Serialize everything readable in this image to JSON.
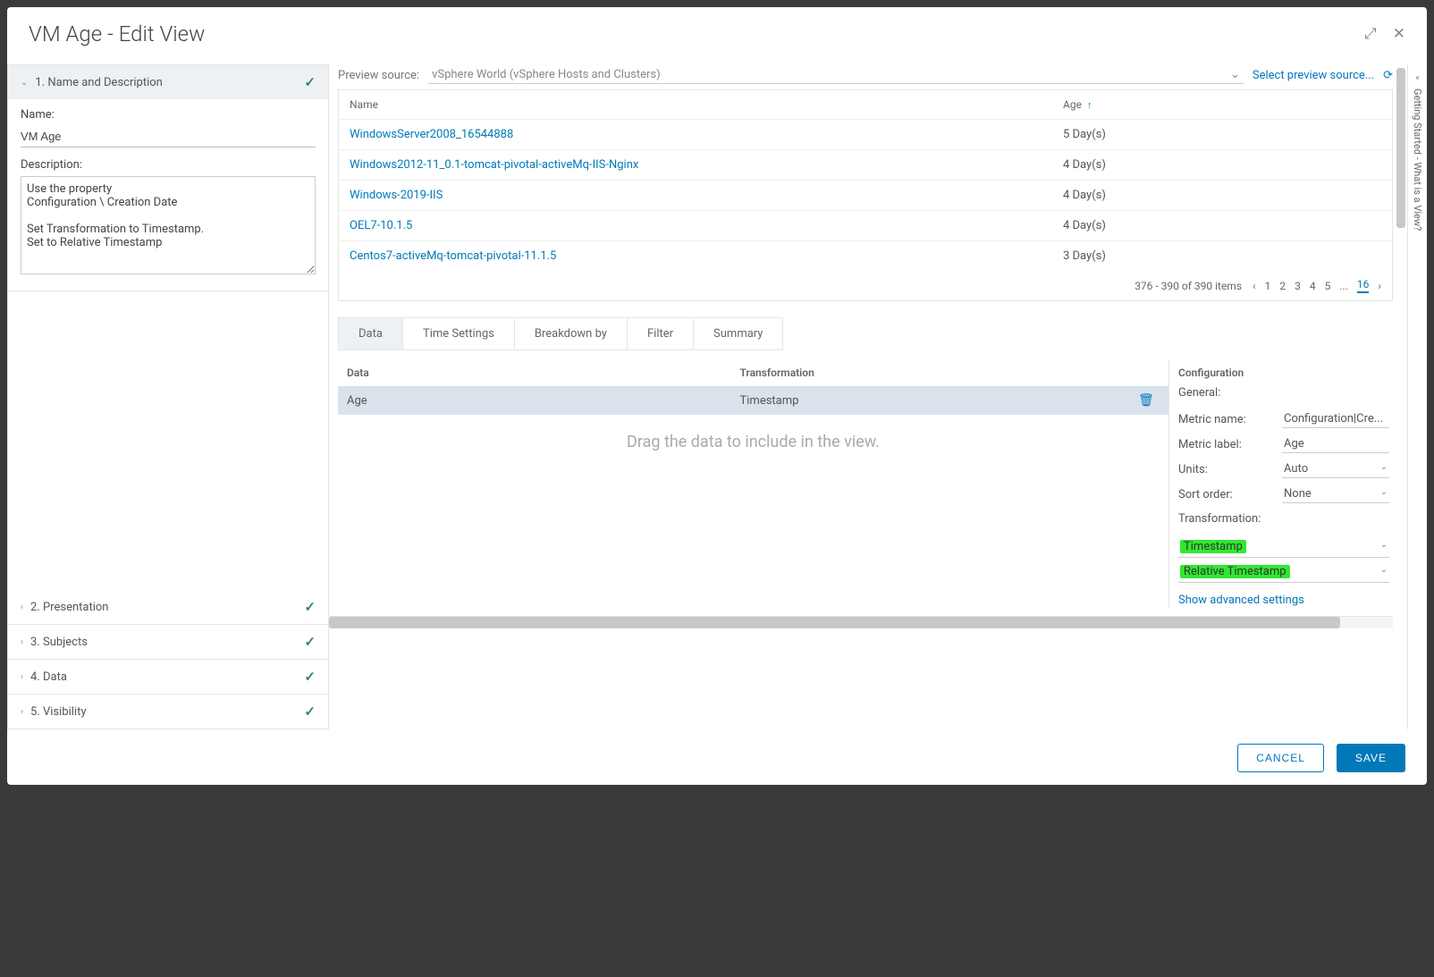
{
  "dialog": {
    "title": "VM Age - Edit View",
    "cancel": "CANCEL",
    "save": "SAVE"
  },
  "sidebar": {
    "items": [
      {
        "label": "1. Name and Description",
        "expanded": true
      },
      {
        "label": "2. Presentation",
        "expanded": false
      },
      {
        "label": "3. Subjects",
        "expanded": false
      },
      {
        "label": "4. Data",
        "expanded": false
      },
      {
        "label": "5. Visibility",
        "expanded": false
      }
    ],
    "form": {
      "name_label": "Name:",
      "name_value": "VM Age",
      "desc_label": "Description:",
      "desc_value": "Use the property\nConfiguration \\ Creation Date\n\nSet Transformation to Timestamp.\nSet to Relative Timestamp"
    }
  },
  "preview": {
    "label": "Preview source:",
    "source": "vSphere World (vSphere Hosts and Clusters)",
    "select_link": "Select preview source...",
    "columns": {
      "name": "Name",
      "age": "Age"
    },
    "sort": {
      "column": "Age",
      "dir": "asc"
    },
    "rows": [
      {
        "name": "WindowsServer2008_16544888",
        "age": "5 Day(s)"
      },
      {
        "name": "Windows2012-11_0.1-tomcat-pivotal-activeMq-IIS-Nginx",
        "age": "4 Day(s)"
      },
      {
        "name": "Windows-2019-IIS",
        "age": "4 Day(s)"
      },
      {
        "name": "OEL7-10.1.5",
        "age": "4 Day(s)"
      },
      {
        "name": "Centos7-activeMq-tomcat-pivotal-11.1.5",
        "age": "3 Day(s)"
      }
    ],
    "pager": {
      "summary": "376 - 390 of 390 items",
      "pages": [
        "1",
        "2",
        "3",
        "4",
        "5",
        "...",
        "16"
      ],
      "current": "16"
    }
  },
  "tabs": [
    "Data",
    "Time Settings",
    "Breakdown by",
    "Filter",
    "Summary"
  ],
  "active_tab": "Data",
  "data_table": {
    "headers": {
      "data": "Data",
      "transformation": "Transformation"
    },
    "row": {
      "data": "Age",
      "transformation": "Timestamp"
    },
    "hint": "Drag the data to include in the view."
  },
  "config": {
    "header": "Configuration",
    "general_label": "General:",
    "metric_name_label": "Metric name:",
    "metric_name_value": "Configuration|Cre...",
    "metric_label_label": "Metric label:",
    "metric_label_value": "Age",
    "units_label": "Units:",
    "units_value": "Auto",
    "sort_label": "Sort order:",
    "sort_value": "None",
    "transformation_label": "Transformation:",
    "transformation_value": "Timestamp",
    "transformation_sub_value": "Relative Timestamp",
    "advanced_link": "Show advanced settings"
  },
  "side_tab": "Getting Started - What is a View?"
}
